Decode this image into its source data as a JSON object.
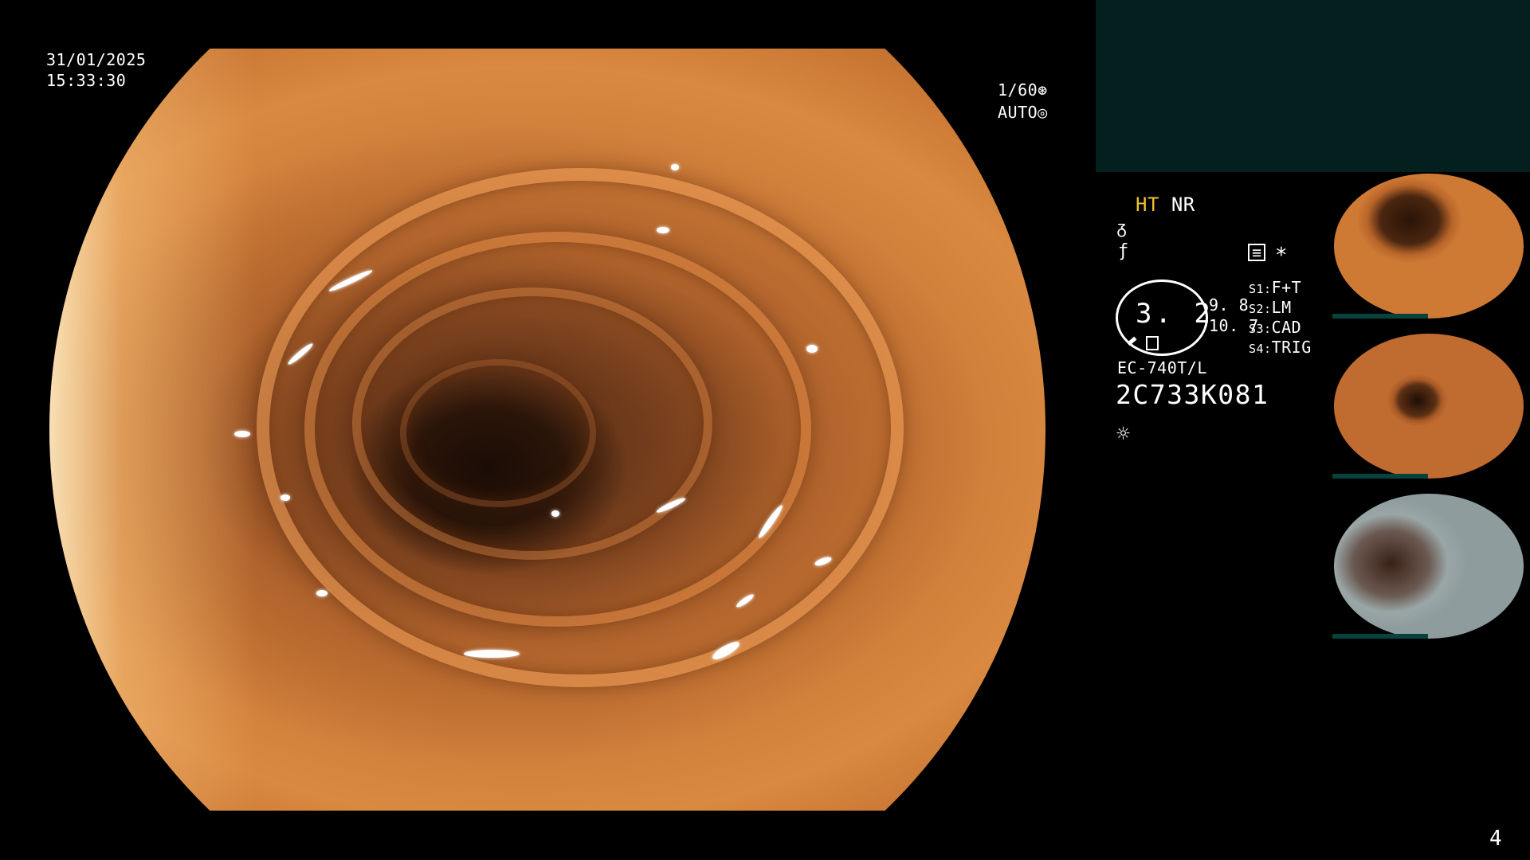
{
  "overlay": {
    "date": "31/01/2025",
    "time": "15:33:30",
    "shutter": "1/60",
    "shutter_icon": "aperture-icon",
    "mode": "AUTO",
    "mode_icon": "target-icon"
  },
  "panel": {
    "ht": "HT",
    "nr": "NR",
    "icon_curve": "tone-curve-icon",
    "icon_enhance": "enhancement-icon",
    "icon_record": "record-icon",
    "asterisk": "*",
    "dial_value": "3. 2",
    "value_1": "9. 8",
    "value_2": "10. 7",
    "slots": [
      {
        "key": "S1:",
        "value": "F+T"
      },
      {
        "key": "S2:",
        "value": "LM"
      },
      {
        "key": "S3:",
        "value": "CAD"
      },
      {
        "key": "S4:",
        "value": "TRIG"
      }
    ],
    "scope_model": "EC-740T/L",
    "serial": "2C733K081",
    "light_icon": "light-source-icon"
  },
  "colors": {
    "highlight": "#f0c030",
    "teal_box": "#03201f"
  },
  "page_number": "4"
}
